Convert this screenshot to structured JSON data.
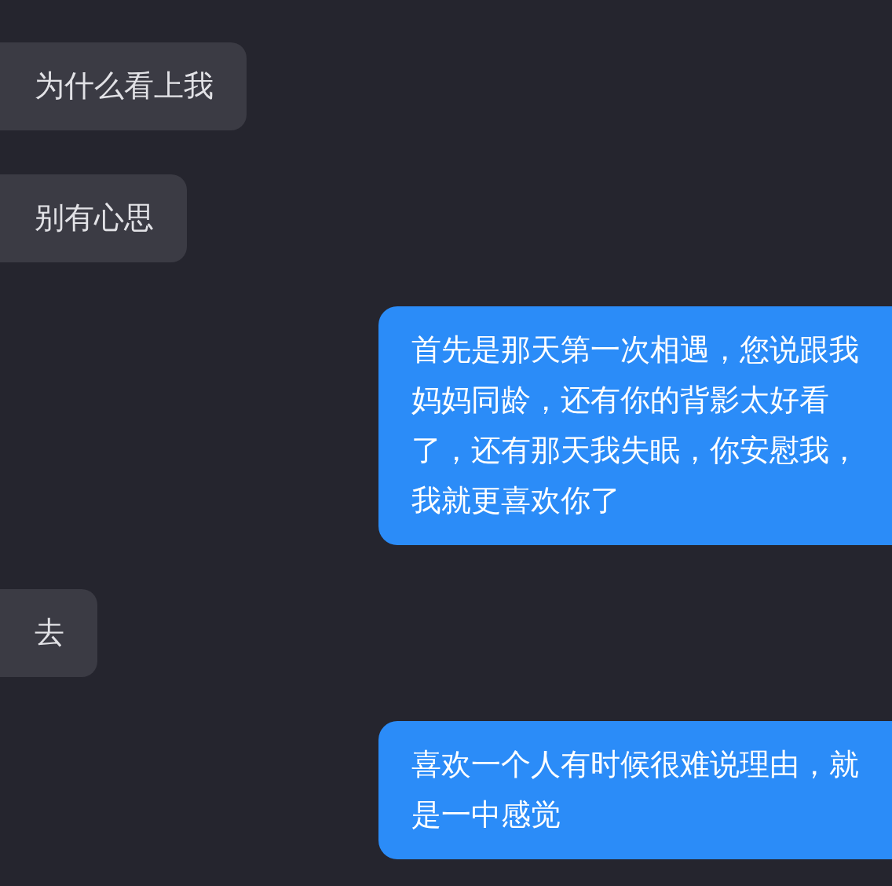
{
  "messages": [
    {
      "kind": "received",
      "text": "为什么看上我"
    },
    {
      "kind": "received",
      "text": "别有心思"
    },
    {
      "kind": "sent",
      "text": "首先是那天第一次相遇，您说跟我妈妈同龄，还有你的背影太好看了，还有那天我失眠，你安慰我，我就更喜欢你了"
    },
    {
      "kind": "received",
      "text": "去"
    },
    {
      "kind": "sent",
      "text": "喜欢一个人有时候很难说理由，就是一中感觉"
    }
  ]
}
